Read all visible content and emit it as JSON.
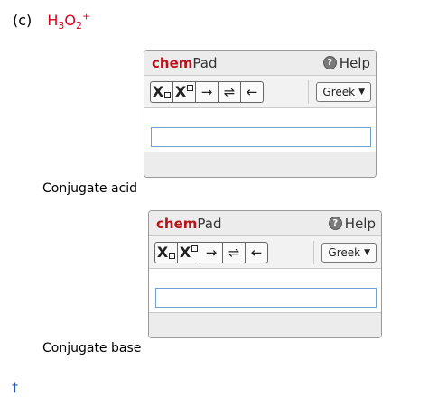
{
  "question": {
    "letter": "(c)",
    "species_prefix": "H",
    "sub1": "3",
    "species_mid": "O",
    "sub2": "2",
    "charge": "+"
  },
  "chempad": {
    "logo_chem": "chem",
    "logo_pad": "Pad",
    "help_label": "Help",
    "greek_label": "Greek",
    "buttons": {
      "subscript": "X",
      "superscript": "X",
      "arrow_right": "→",
      "arrow_equilibrium": "⇌",
      "arrow_left": "←"
    }
  },
  "labels": {
    "acid": "Conjugate acid",
    "base": "Conjugate base"
  },
  "footnote": "†",
  "colors": {
    "species": "#e0001b",
    "chem_brand": "#b5121b",
    "input_border": "#6fa0d0",
    "footnote": "#2a5db0"
  }
}
